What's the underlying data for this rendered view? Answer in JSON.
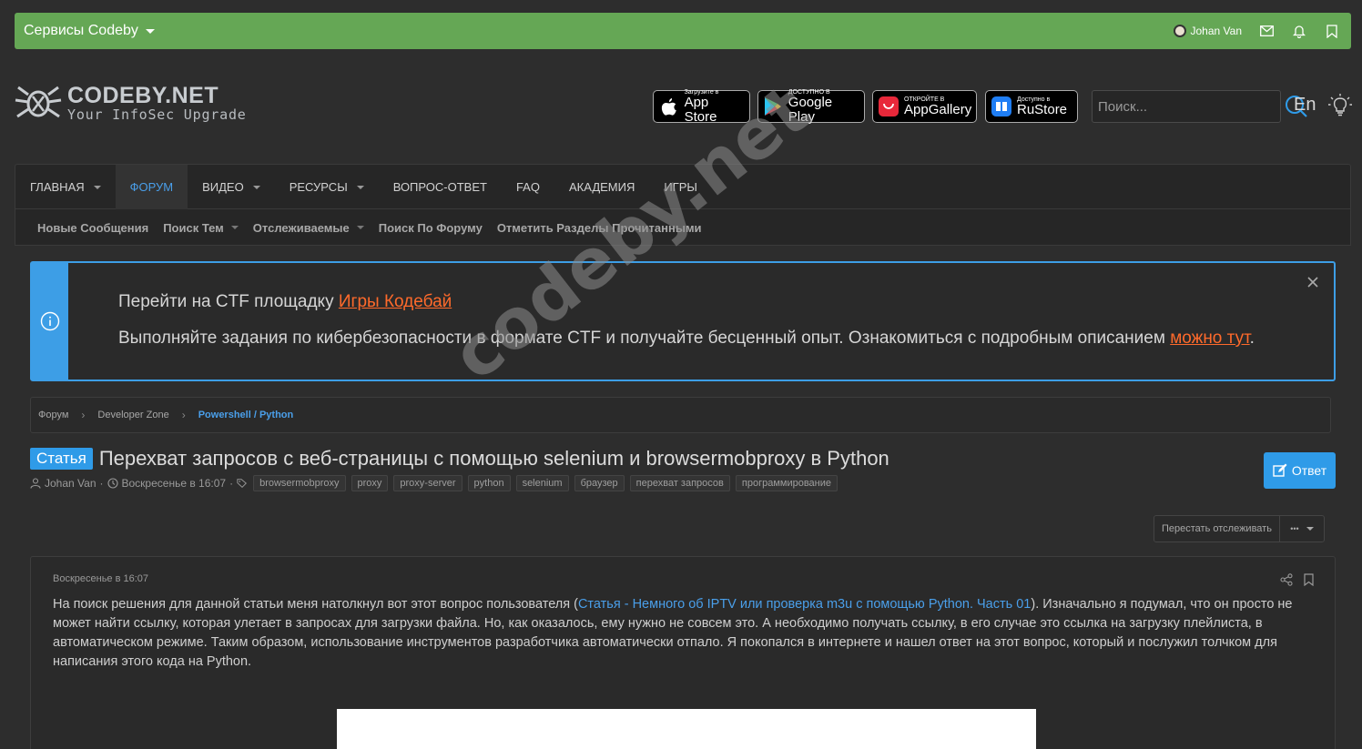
{
  "services_bar": {
    "title": "Сервисы Codeby",
    "username": "Johan Van"
  },
  "header": {
    "logo_name": "CODEBY.NET",
    "logo_tagline": "Your InfoSec Upgrade",
    "stores": [
      {
        "small": "Загрузите в",
        "large": "App Store"
      },
      {
        "small": "ДОСТУПНО В",
        "large": "Google Play"
      },
      {
        "small": "ОТКРОЙТЕ В",
        "large": "AppGallery"
      },
      {
        "small": "Доступно в",
        "large": "RuStore"
      }
    ],
    "search_placeholder": "Поиск...",
    "language": "En"
  },
  "nav": {
    "tabs": [
      {
        "label": "Главная",
        "caret": true
      },
      {
        "label": "Форум",
        "caret": false,
        "active": true
      },
      {
        "label": "Видео",
        "caret": true
      },
      {
        "label": "Ресурсы",
        "caret": true
      },
      {
        "label": "Вопрос-ответ",
        "caret": false
      },
      {
        "label": "FAQ",
        "caret": false
      },
      {
        "label": "Академия",
        "caret": false
      },
      {
        "label": "Игры",
        "caret": false
      }
    ],
    "sub": [
      {
        "label": "Новые Сообщения",
        "caret": false
      },
      {
        "label": "Поиск Тем",
        "caret": true
      },
      {
        "label": "Отслеживаемые",
        "caret": true
      },
      {
        "label": "Поиск По Форуму",
        "caret": false
      },
      {
        "label": "Отметить Разделы Прочитанными",
        "caret": false
      }
    ]
  },
  "notice": {
    "line1_text": "Перейти на CTF площадку ",
    "line1_link": "Игры Кодебай",
    "line2_text": "Выполняйте задания по кибербезопасности в формате CTF и получайте бесценный опыт. Ознакомиться с подробным описанием ",
    "line2_link": "можно тут",
    "line2_end": "."
  },
  "breadcrumb": [
    "Форум",
    "Developer Zone",
    "Powershell / Python"
  ],
  "thread": {
    "badge": "Статья",
    "title": "Перехват запросов с веб-страницы с помощью selenium и browsermobproxy в Python",
    "author": "Johan Van",
    "date": "Воскресенье в 16:07",
    "tags": [
      "browsermobproxy",
      "proxy",
      "proxy-server",
      "python",
      "selenium",
      "браузер",
      "перехват запросов",
      "программирование"
    ],
    "reply_label": "Ответ",
    "unwatch_label": "Перестать отслеживать",
    "more_label": "•••"
  },
  "post": {
    "date": "Воскресенье в 16:07",
    "text_before": "На поиск решения для данной статьи меня натолкнул вот этот вопрос пользователя (",
    "link": "Статья - Немного об IPTV или проверка m3u с помощью Python. Часть 01",
    "text_after": "). Изначально я подумал, что он просто не может найти ссылку, которая улетает в запросах для загрузки файла. Но, как оказалось, ему нужно не совсем это. А необходимо получать ссылку, в его случае это ссылка на загрузку плейлиста, в автоматическом режиме. Таким образом, использование инструментов разработчика автоматически отпало. Я покопался в интернете и нашел ответ на этот вопрос, который и послужил толчком для написания этого кода на Python."
  },
  "watermark": "codeby.net",
  "colors": {
    "services_green": "#65a755",
    "accent_blue": "#2f9be8",
    "link_orange": "#ff6a2b",
    "background": "#2d2d2d"
  }
}
